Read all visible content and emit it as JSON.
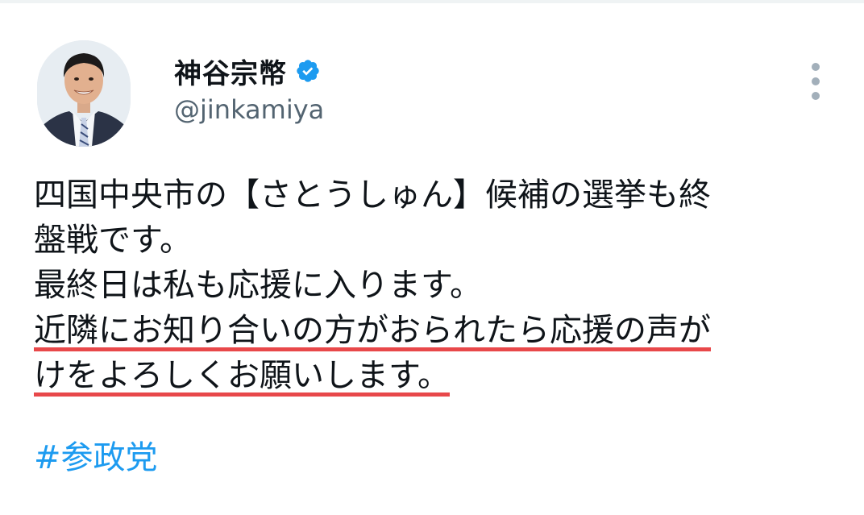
{
  "author": {
    "name": "神谷宗幣",
    "handle": "@jinkamiya",
    "verified": true
  },
  "tweet": {
    "lines": [
      "四国中央市の【さとうしゅん】候補の選挙も終",
      "盤戦です。",
      "最終日は私も応援に入ります。",
      "近隣にお知り合いの方がおられたら応援の声が",
      "けをよろしくお願いします。"
    ],
    "hashtag": "#参政党"
  },
  "colors": {
    "text": "#0f1419",
    "secondary": "#536471",
    "link": "#1d9bf0",
    "verified_badge": "#1d9bf0",
    "underline_marker": "#e8484a"
  },
  "icons": {
    "verified": "verified-badge-icon",
    "more": "more-options-icon"
  }
}
